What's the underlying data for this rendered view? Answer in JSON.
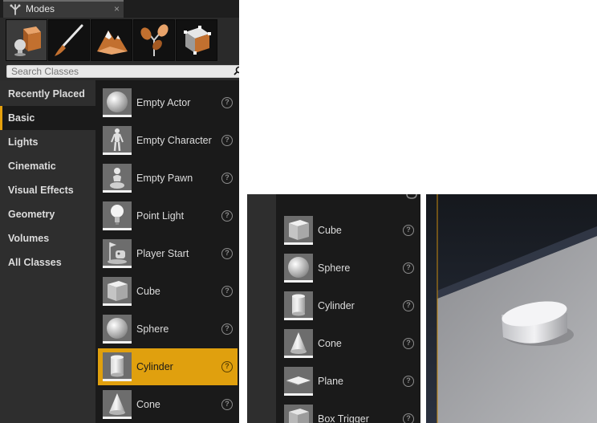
{
  "modes_panel": {
    "tab": {
      "label": "Modes",
      "close": "×"
    },
    "tools": [
      "place-mode-icon",
      "paint-mode-icon",
      "landscape-mode-icon",
      "foliage-mode-icon",
      "geometry-edit-mode-icon"
    ],
    "search": {
      "placeholder": "Search Classes"
    },
    "categories": [
      {
        "label": "Recently Placed"
      },
      {
        "label": "Basic"
      },
      {
        "label": "Lights"
      },
      {
        "label": "Cinematic"
      },
      {
        "label": "Visual Effects"
      },
      {
        "label": "Geometry"
      },
      {
        "label": "Volumes"
      },
      {
        "label": "All Classes"
      }
    ],
    "active_category": "Basic",
    "items": [
      {
        "label": "Empty Actor",
        "icon": "sphere-icon"
      },
      {
        "label": "Empty Character",
        "icon": "character-icon"
      },
      {
        "label": "Empty Pawn",
        "icon": "pawn-icon"
      },
      {
        "label": "Point Light",
        "icon": "light-bulb-icon"
      },
      {
        "label": "Player Start",
        "icon": "player-start-icon"
      },
      {
        "label": "Cube",
        "icon": "cube-icon"
      },
      {
        "label": "Sphere",
        "icon": "sphere-icon"
      },
      {
        "label": "Cylinder",
        "icon": "cylinder-icon"
      },
      {
        "label": "Cone",
        "icon": "cone-icon"
      }
    ],
    "selected_item": "Cylinder",
    "help_glyph": "?"
  },
  "zoomed_panel": {
    "items": [
      {
        "label": "Cube",
        "icon": "cube-icon"
      },
      {
        "label": "Sphere",
        "icon": "sphere-icon"
      },
      {
        "label": "Cylinder",
        "icon": "cylinder-icon"
      },
      {
        "label": "Cone",
        "icon": "cone-icon"
      },
      {
        "label": "Plane",
        "icon": "plane-icon"
      },
      {
        "label": "Box Trigger",
        "icon": "box-trigger-icon"
      }
    ],
    "help_glyph": "?"
  },
  "colors": {
    "accent": "#e0a00e",
    "panel_bg": "#1a1a1a",
    "category_bg": "#2e2e2e"
  }
}
